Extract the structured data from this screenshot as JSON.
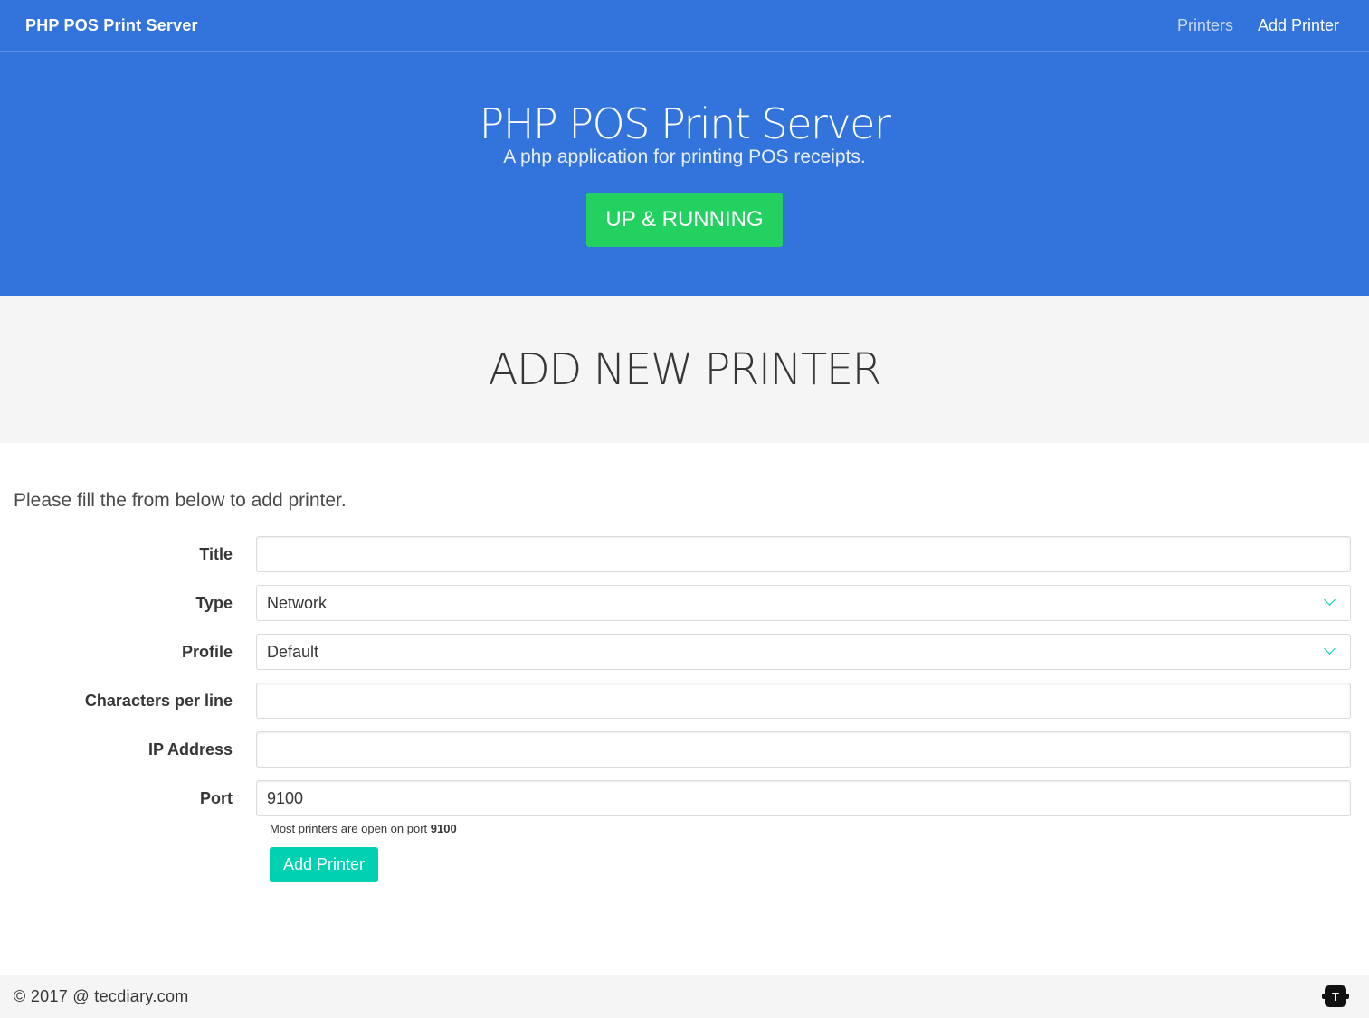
{
  "navbar": {
    "brand": "PHP POS Print Server",
    "links": [
      {
        "label": "Printers"
      },
      {
        "label": "Add Printer"
      }
    ]
  },
  "hero": {
    "title": "PHP POS Print Server",
    "subtitle": "A php application for printing POS receipts.",
    "status_label": "UP & RUNNING"
  },
  "section": {
    "title": "ADD NEW PRINTER"
  },
  "form": {
    "intro": "Please fill the from below to add printer.",
    "title_label": "Title",
    "title_value": "",
    "type_label": "Type",
    "type_value": "Network",
    "profile_label": "Profile",
    "profile_value": "Default",
    "chars_label": "Characters per line",
    "chars_value": "",
    "ip_label": "IP Address",
    "ip_value": "",
    "port_label": "Port",
    "port_value": "9100",
    "help_prefix": "Most printers are open on port ",
    "help_port": "9100",
    "submit_label": "Add Printer"
  },
  "footer": {
    "copyright": "© 2017 @ tecdiary.com",
    "logo_letter": "T"
  },
  "colors": {
    "primary": "#3273dc",
    "success": "#23d160",
    "accent": "#00d1b2"
  }
}
